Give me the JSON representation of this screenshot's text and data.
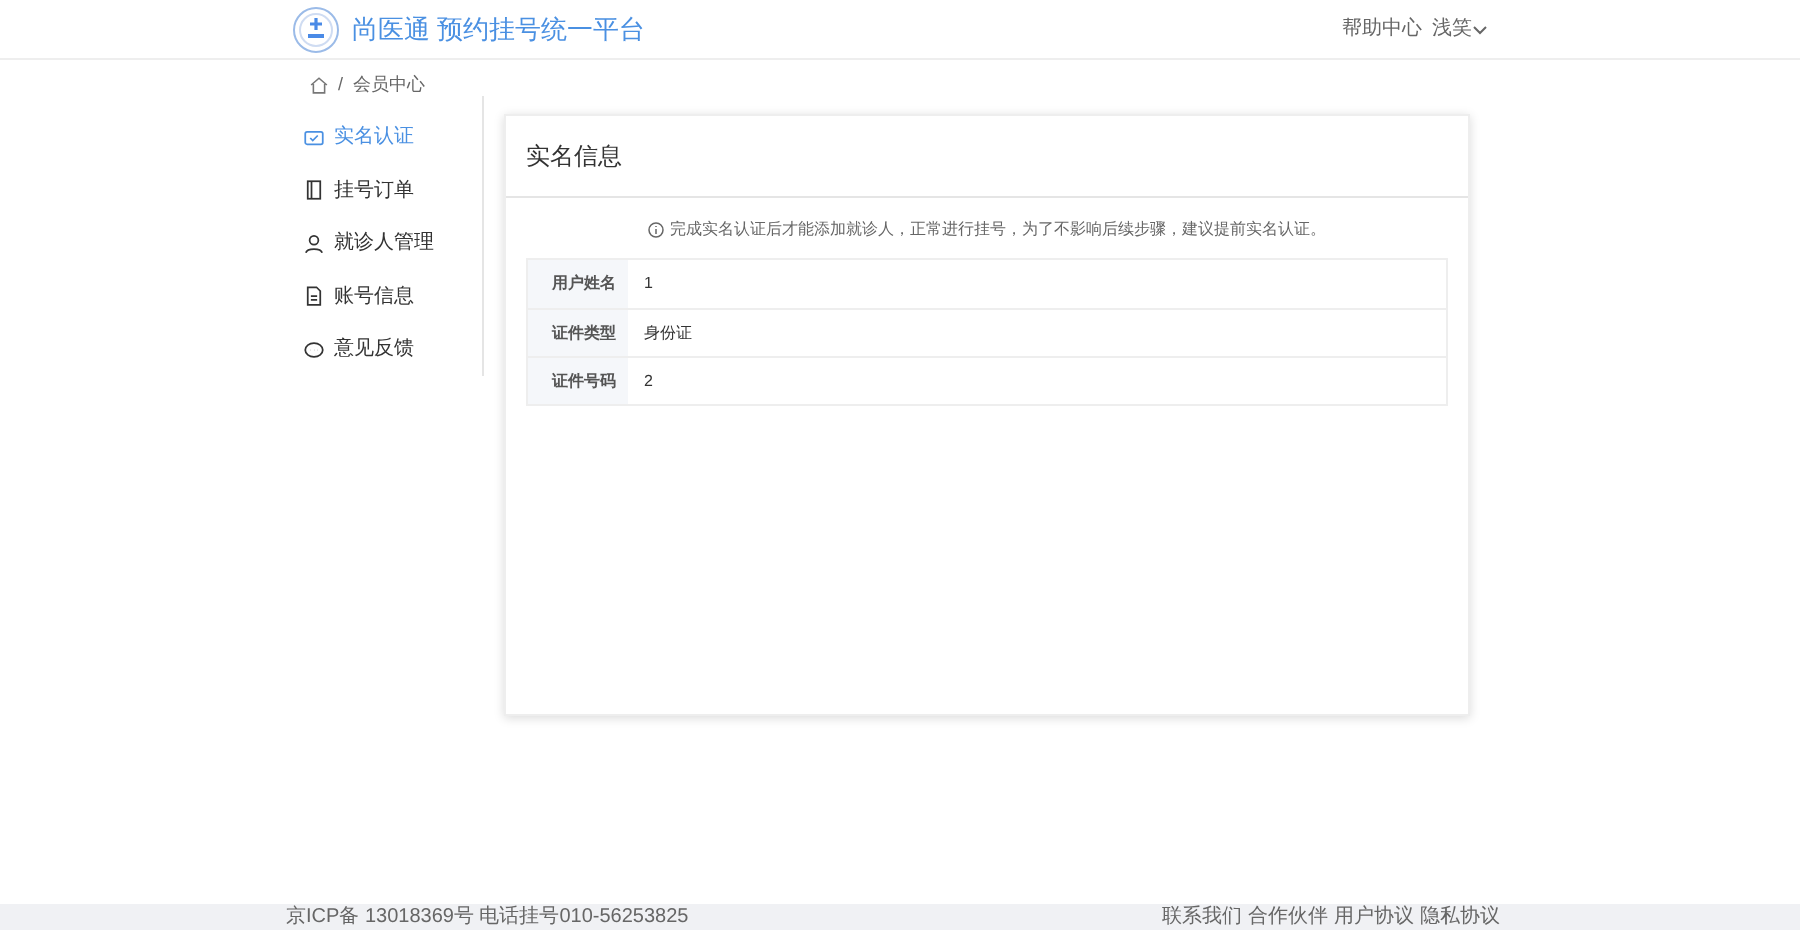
{
  "header": {
    "logo_text": "尚医通 预约挂号统一平台",
    "links": [
      {
        "label": "帮助中心"
      },
      {
        "label": "浅笑",
        "dropdown": true
      }
    ]
  },
  "breadcrumb": {
    "separator": "/",
    "items": [
      "会员中心"
    ]
  },
  "sidebar": {
    "items": [
      {
        "label": "实名认证",
        "kind": "id",
        "selected": true
      },
      {
        "label": "挂号订单",
        "kind": "book",
        "selected": false
      },
      {
        "label": "就诊人管理",
        "kind": "user",
        "selected": false
      },
      {
        "label": "账号信息",
        "kind": "doc",
        "selected": false
      },
      {
        "label": "意见反馈",
        "kind": "chat",
        "selected": false
      }
    ]
  },
  "card": {
    "title": "实名信息",
    "notice": "完成实名认证后才能添加就诊人，正常进行挂号，为了不影响后续步骤，建议提前实名认证。",
    "rows": [
      {
        "label": "用户姓名",
        "value": "1"
      },
      {
        "label": "证件类型",
        "value": "身份证"
      },
      {
        "label": "证件号码",
        "value": "2"
      }
    ]
  },
  "footer": {
    "left": "京ICP备 13018369号 电话挂号010-56253825",
    "links": [
      "联系我们",
      "合作伙伴",
      "用户协议",
      "隐私协议"
    ]
  }
}
